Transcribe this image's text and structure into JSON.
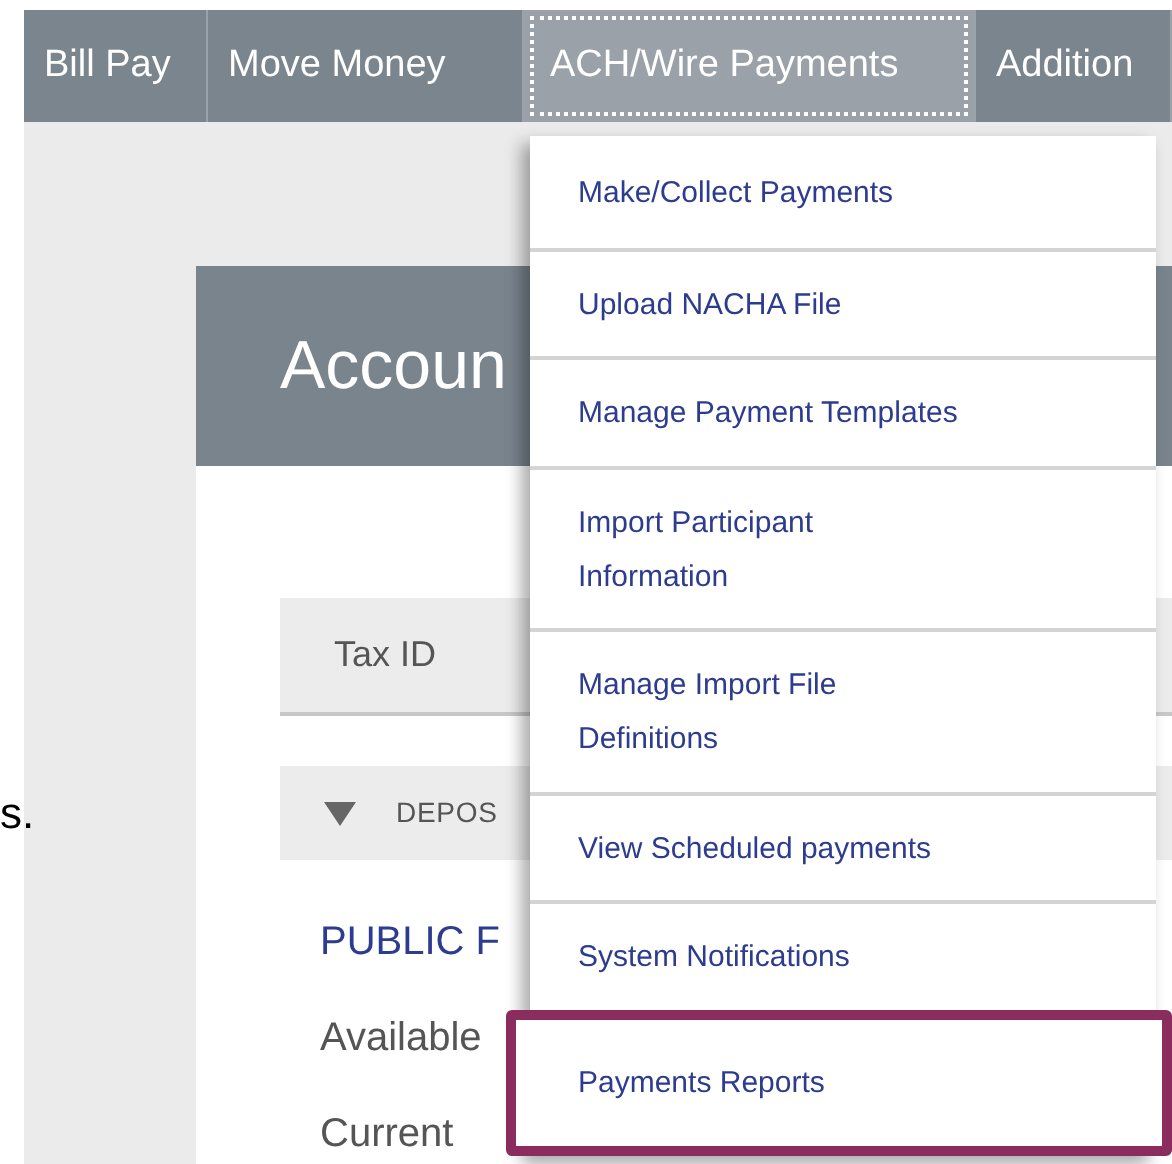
{
  "side_text": "s.",
  "nav": {
    "items": [
      {
        "label": "Bill Pay",
        "selected": false
      },
      {
        "label": "Move Money",
        "selected": false
      },
      {
        "label": "ACH/Wire Payments",
        "selected": true
      },
      {
        "label": "Addition",
        "selected": false
      }
    ]
  },
  "dropdown": {
    "items": [
      {
        "label": "Make/Collect Payments",
        "highlighted": false
      },
      {
        "label": "Upload NACHA File",
        "highlighted": false
      },
      {
        "label": "Manage Payment Templates",
        "highlighted": false
      },
      {
        "label": "Import Participant\nInformation",
        "highlighted": false
      },
      {
        "label": "Manage Import File\nDefinitions",
        "highlighted": false
      },
      {
        "label": "View Scheduled payments",
        "highlighted": false
      },
      {
        "label": "System Notifications",
        "highlighted": false
      },
      {
        "label": "Payments Reports",
        "highlighted": true
      }
    ]
  },
  "card": {
    "title": "Accoun",
    "filter_bar": {
      "label": "Tax ID"
    },
    "section": {
      "label": "DEPOS",
      "expanded": true
    },
    "account": {
      "name": "PUBLIC F",
      "fields": [
        "Available",
        "Current"
      ]
    }
  }
}
